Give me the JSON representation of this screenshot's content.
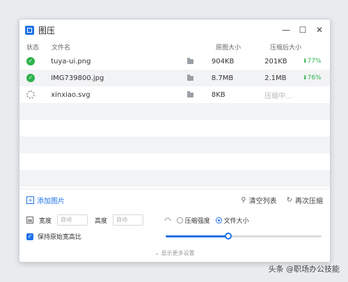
{
  "window": {
    "title": "图压",
    "controls": {
      "minimize": "—",
      "maximize": "☐",
      "close": "✕"
    }
  },
  "table": {
    "headers": {
      "status": "状态",
      "name": "文件名",
      "original": "原图大小",
      "compressed": "压缩后大小"
    },
    "rows": [
      {
        "status": "done",
        "name": "tuya-ui.png",
        "original": "904KB",
        "compressed": "201KB",
        "ratio": "77%"
      },
      {
        "status": "done",
        "name": "IMG739800.jpg",
        "original": "8.7MB",
        "compressed": "2.1MB",
        "ratio": "76%"
      },
      {
        "status": "compressing",
        "name": "xinxiao.svg",
        "original": "8KB",
        "compressed": "压缩中...",
        "ratio": ""
      }
    ]
  },
  "actions": {
    "add": "添加图片",
    "clear": "清空列表",
    "recompress": "再次压缩"
  },
  "settings": {
    "width_label": "宽度",
    "width_placeholder": "自动",
    "height_label": "高度",
    "height_placeholder": "自动",
    "mode_quality": "压缩强度",
    "mode_size": "文件大小",
    "mode_selected": "文件大小",
    "keep_ratio": "保持原始宽高比",
    "keep_ratio_checked": true,
    "slider_level": 0.4,
    "more": "显示更多设置"
  },
  "watermark": "头条 @职场办公技能",
  "colors": {
    "accent": "#1e73e8",
    "success": "#2db24b"
  }
}
